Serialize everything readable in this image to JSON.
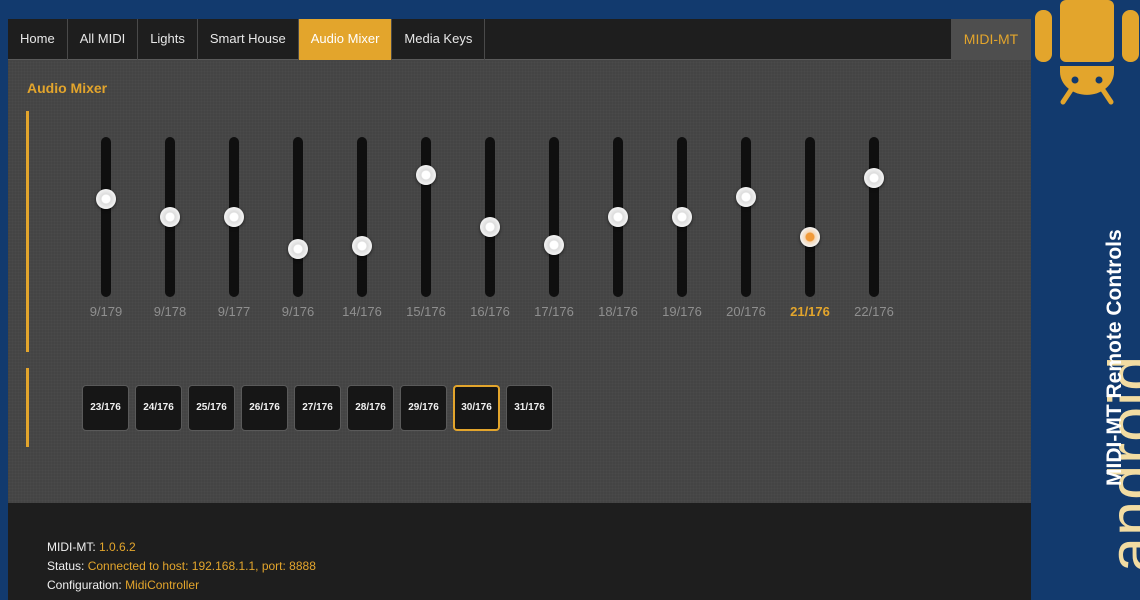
{
  "nav": {
    "tabs": [
      {
        "label": "Home",
        "active": false
      },
      {
        "label": "All MIDI",
        "active": false
      },
      {
        "label": "Lights",
        "active": false
      },
      {
        "label": "Smart House",
        "active": false
      },
      {
        "label": "Audio Mixer",
        "active": true
      },
      {
        "label": "Media Keys",
        "active": false
      }
    ],
    "brand": "MIDI-MT"
  },
  "panel": {
    "title": "Audio Mixer",
    "sliders": [
      {
        "label": "9/179",
        "level": 0.63,
        "active": false
      },
      {
        "label": "9/178",
        "level": 0.5,
        "active": false
      },
      {
        "label": "9/177",
        "level": 0.5,
        "active": false
      },
      {
        "label": "9/176",
        "level": 0.27,
        "active": false
      },
      {
        "label": "14/176",
        "level": 0.29,
        "active": false
      },
      {
        "label": "15/176",
        "level": 0.8,
        "active": false
      },
      {
        "label": "16/176",
        "level": 0.43,
        "active": false
      },
      {
        "label": "17/176",
        "level": 0.3,
        "active": false
      },
      {
        "label": "18/176",
        "level": 0.5,
        "active": false
      },
      {
        "label": "19/176",
        "level": 0.5,
        "active": false
      },
      {
        "label": "20/176",
        "level": 0.64,
        "active": false
      },
      {
        "label": "21/176",
        "level": 0.36,
        "active": true
      },
      {
        "label": "22/176",
        "level": 0.78,
        "active": false
      }
    ],
    "buttons": [
      {
        "label": "23/176",
        "selected": false
      },
      {
        "label": "24/176",
        "selected": false
      },
      {
        "label": "25/176",
        "selected": false
      },
      {
        "label": "26/176",
        "selected": false
      },
      {
        "label": "27/176",
        "selected": false
      },
      {
        "label": "28/176",
        "selected": false
      },
      {
        "label": "29/176",
        "selected": false
      },
      {
        "label": "30/176",
        "selected": true
      },
      {
        "label": "31/176",
        "selected": false
      }
    ]
  },
  "footer": {
    "version_label": "MIDI-MT:",
    "version_value": "1.0.6.2",
    "status_label": "Status:",
    "status_value": "Connected to host: 192.168.1.1, port: 8888",
    "config_label": "Configuration:",
    "config_value": "MidiController"
  },
  "side_brand": {
    "title": "MIDI-MT Remote Controls",
    "platform": "android",
    "logo_icon": "android-robot-icon",
    "logo_color": "#e3a52c"
  },
  "colors": {
    "accent": "#e3a52c",
    "background": "#123a6e",
    "panel": "#444444",
    "bar": "#1e1e1e"
  }
}
